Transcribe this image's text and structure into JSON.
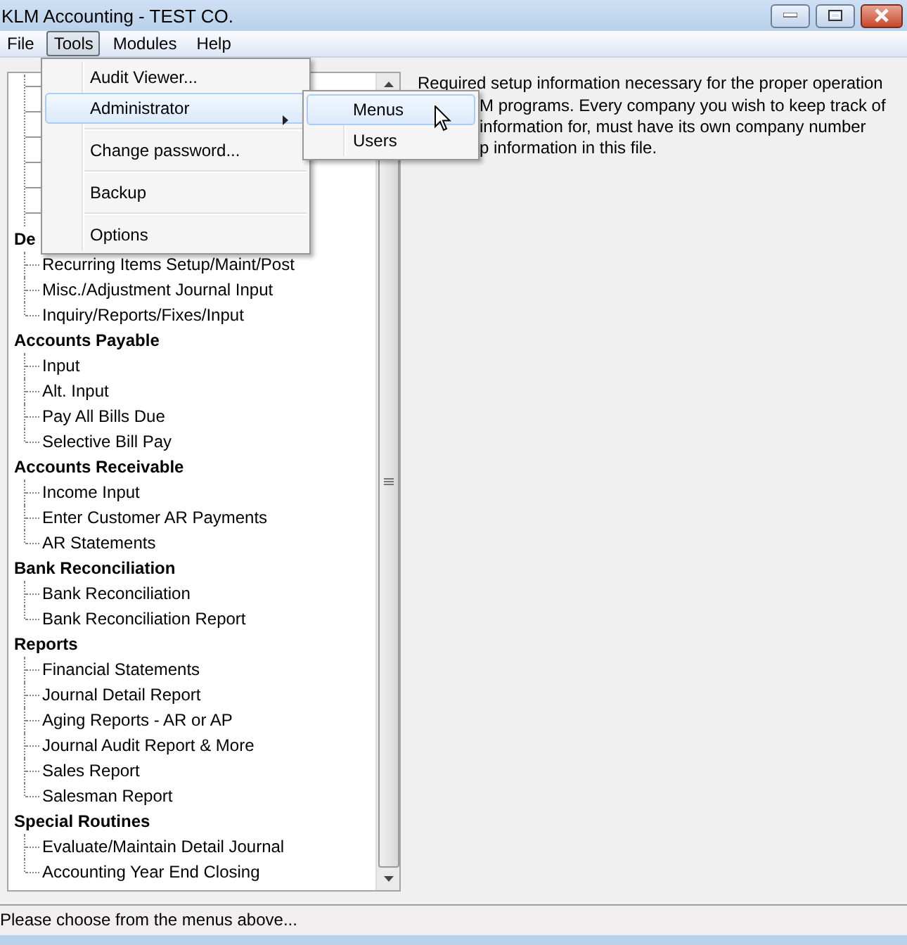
{
  "window": {
    "title": "KLM Accounting - TEST CO."
  },
  "menubar": [
    {
      "label": "File",
      "selected": false
    },
    {
      "label": "Tools",
      "selected": true
    },
    {
      "label": "Modules",
      "selected": false
    },
    {
      "label": "Help",
      "selected": false
    }
  ],
  "tools_menu": [
    {
      "kind": "item",
      "label": "Audit Viewer...",
      "selected": false,
      "has_submenu": false
    },
    {
      "kind": "item",
      "label": "Administrator",
      "selected": true,
      "has_submenu": true
    },
    {
      "kind": "separator"
    },
    {
      "kind": "item",
      "label": "Change password...",
      "selected": false,
      "has_submenu": false
    },
    {
      "kind": "separator"
    },
    {
      "kind": "item",
      "label": "Backup",
      "selected": false,
      "has_submenu": false
    },
    {
      "kind": "separator"
    },
    {
      "kind": "item",
      "label": "Options",
      "selected": false,
      "has_submenu": false
    }
  ],
  "administrator_submenu": [
    {
      "label": "Menus",
      "selected": true
    },
    {
      "label": "Users",
      "selected": false
    }
  ],
  "tree": [
    {
      "label": "De",
      "children": [
        "Recurring Items Setup/Maint/Post",
        "Misc./Adjustment Journal Input",
        "Inquiry/Reports/Fixes/Input"
      ]
    },
    {
      "label": "Accounts Payable",
      "children": [
        "Input",
        "Alt. Input",
        "Pay All Bills Due",
        "Selective Bill Pay"
      ]
    },
    {
      "label": "Accounts Receivable",
      "children": [
        "Income Input",
        "Enter Customer AR Payments",
        "AR Statements"
      ]
    },
    {
      "label": "Bank Reconciliation",
      "children": [
        "Bank Reconciliation",
        "Bank Reconciliation Report"
      ]
    },
    {
      "label": "Reports",
      "children": [
        "Financial Statements",
        "Journal Detail Report",
        "Aging Reports - AR or AP",
        "Journal Audit Report & More",
        "Sales Report",
        "Salesman Report"
      ]
    },
    {
      "label": "Special Routines",
      "children": [
        "Evaluate/Maintain Detail Journal",
        "Accounting Year End Closing"
      ]
    }
  ],
  "description": [
    "Required setup information necessary for the proper operation",
    "M programs. Every company you wish to keep track of",
    "information for, must have its own company number",
    "p information in this file."
  ],
  "status_bar": "Please choose from the menus above..."
}
